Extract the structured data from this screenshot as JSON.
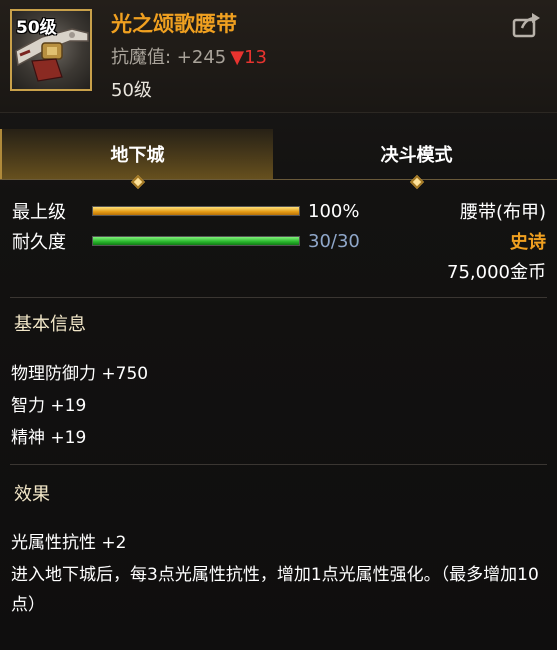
{
  "item": {
    "level_badge": "50级",
    "name": "光之颂歌腰带",
    "stat_label": "抗魔值: +245",
    "stat_diff_arrow": "▼",
    "stat_diff": "13",
    "level_text": "50级",
    "icon": "belt-item-icon",
    "share_icon": "share-export-icon"
  },
  "tabs": [
    {
      "label": "地下城",
      "active": true
    },
    {
      "label": "决斗模式",
      "active": false
    }
  ],
  "bars": [
    {
      "label": "最上级",
      "value_text": "100%",
      "fraction": 1.0,
      "color": "#e39a14"
    },
    {
      "label": "耐久度",
      "value_text": "30/30",
      "fraction": 1.0,
      "color": "#27b52a"
    }
  ],
  "info": {
    "type": "腰带(布甲)",
    "rarity": "史诗",
    "price": "75,000金币"
  },
  "basic": {
    "title": "基本信息",
    "lines": [
      "物理防御力 +750",
      "智力 +19",
      "精神 +19"
    ]
  },
  "effect": {
    "title": "效果",
    "line1": "光属性抗性 +2",
    "line2": "进入地下城后，每3点光属性抗性，增加1点光属性强化。（最多增加10点）"
  },
  "colors": {
    "accent_gold": "#f0a020",
    "negative_red": "#e8332f",
    "durability_blue": "#8fa7c9"
  }
}
